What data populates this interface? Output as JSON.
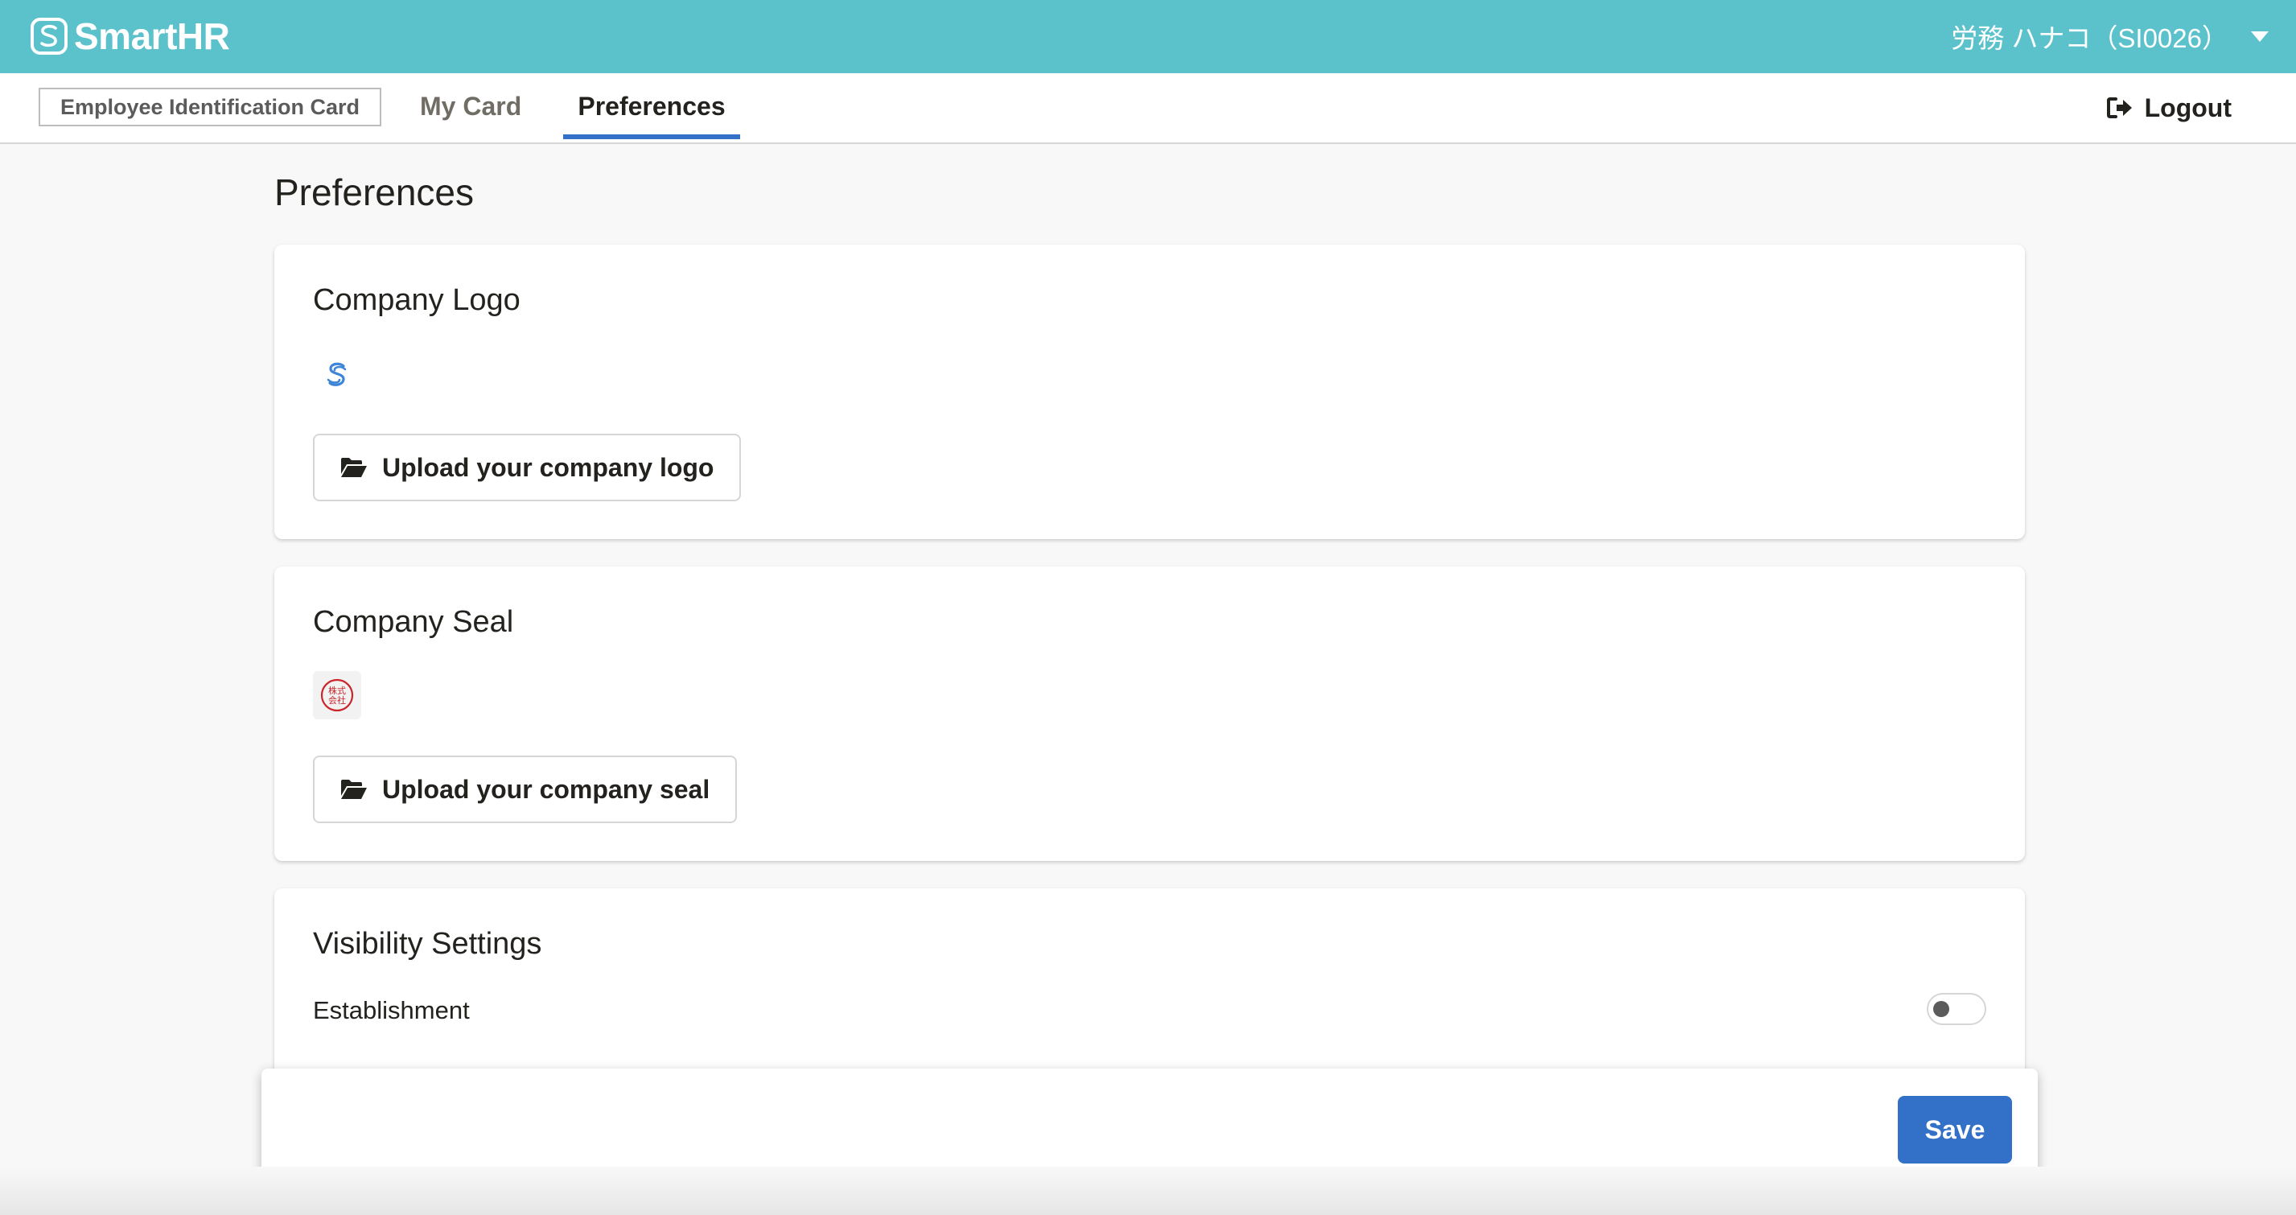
{
  "header": {
    "brand_name": "SmartHR",
    "user_label": "労務 ハナコ（SI0026）",
    "brand_icon": "smarthr-logo-icon",
    "user_menu_icon": "caret-down-icon"
  },
  "nav": {
    "app_label": "Employee Identification Card",
    "tabs": [
      {
        "label": "My Card",
        "active": false
      },
      {
        "label": "Preferences",
        "active": true
      }
    ],
    "logout_label": "Logout",
    "logout_icon": "logout-icon"
  },
  "main": {
    "title": "Preferences",
    "logo_card": {
      "title": "Company Logo",
      "upload_label": "Upload your company logo",
      "upload_icon": "folder-open-icon"
    },
    "seal_card": {
      "title": "Company Seal",
      "seal_text_line1": "株式",
      "seal_text_line2": "会社",
      "upload_label": "Upload your company seal",
      "upload_icon": "folder-open-icon"
    },
    "visibility_card": {
      "title": "Visibility Settings",
      "settings": [
        {
          "label": "Establishment",
          "enabled": false
        }
      ]
    }
  },
  "footer": {
    "save_label": "Save"
  },
  "colors": {
    "header_bg": "#5bc2cc",
    "accent": "#3370c7",
    "text": "#23221e",
    "seal_red": "#c9252b"
  }
}
